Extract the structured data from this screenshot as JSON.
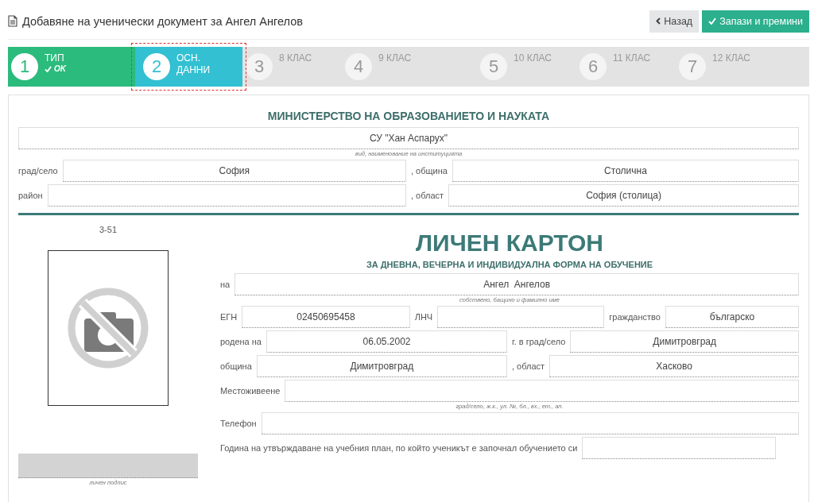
{
  "header": {
    "title": "Добавяне на ученически документ за Ангел Ангелов",
    "buttons": [
      {
        "label": "Назад",
        "kind": "back"
      },
      {
        "label": "Запази и премини",
        "kind": "save"
      }
    ]
  },
  "steps": [
    {
      "number": "1",
      "label": "ТИП",
      "status_text": "OK",
      "done": true,
      "selected": false,
      "highlighted": false
    },
    {
      "number": "2",
      "label": "ОСН. ДАННИ",
      "done": false,
      "selected": true,
      "highlighted": true
    },
    {
      "number": "3",
      "label": "8 КЛАС",
      "done": false,
      "selected": false,
      "highlighted": false
    },
    {
      "number": "4",
      "label": "9 КЛАС",
      "done": false,
      "selected": false,
      "highlighted": false
    },
    {
      "number": "5",
      "label": "10 КЛАС",
      "done": false,
      "selected": false,
      "highlighted": false
    },
    {
      "number": "6",
      "label": "11 КЛАС",
      "done": false,
      "selected": false,
      "highlighted": false
    },
    {
      "number": "7",
      "label": "12 КЛАС",
      "done": false,
      "selected": false,
      "highlighted": false
    }
  ],
  "ministry": {
    "title": "МИНИСТЕРСТВО НА ОБРАЗОВАНИЕТО И НАУКАТА",
    "rows": [
      {
        "fields": [
          {
            "value": "СУ \"Хан Аспарух\""
          }
        ],
        "caption": "вид, наименование на институцията"
      },
      {
        "fields": [
          {
            "label": "град/село",
            "value": "София"
          },
          {
            "label": ", община",
            "value": "Столична"
          }
        ]
      },
      {
        "fields": [
          {
            "label": "район"
          },
          {
            "label": ", област",
            "value": "София (столица)"
          }
        ]
      }
    ]
  },
  "card": {
    "code": "3-51",
    "signature_caption": "личен подпис",
    "title": "ЛИЧЕН КАРТОН",
    "subtitle": "ЗА ДНЕВНА, ВЕЧЕРНА И ИНДИВИДУАЛНА ФОРМА НА ОБУЧЕНИЕ",
    "rows": [
      {
        "fields": [
          {
            "label": "на",
            "value": "Ангел  Ангелов"
          }
        ],
        "caption": "собствено, бащино и фамилно име"
      },
      {
        "fields": [
          {
            "label": "ЕГН",
            "value": "02450695458"
          },
          {
            "label": "ЛНЧ"
          },
          {
            "label": "гражданство",
            "value": "българско"
          }
        ]
      },
      {
        "fields": [
          {
            "label": "родена на",
            "value": "06.05.2002"
          },
          {
            "label": "г. в град/село",
            "value": "Димитровград"
          }
        ]
      },
      {
        "fields": [
          {
            "label": "община",
            "value": "Димитровград"
          },
          {
            "label": ", област",
            "value": "Хасково"
          }
        ]
      },
      {
        "fields": [
          {
            "label": "Местоживеене"
          }
        ],
        "caption": "град/село, ж.к., ул. №, бл., вх., ет., ап."
      },
      {
        "fields": [
          {
            "label": "Телефон"
          }
        ]
      },
      {
        "fields": [
          {
            "label": "Година на утвърждаване на учебния план, по който ученикът е започнал обучението си"
          }
        ]
      }
    ]
  }
}
